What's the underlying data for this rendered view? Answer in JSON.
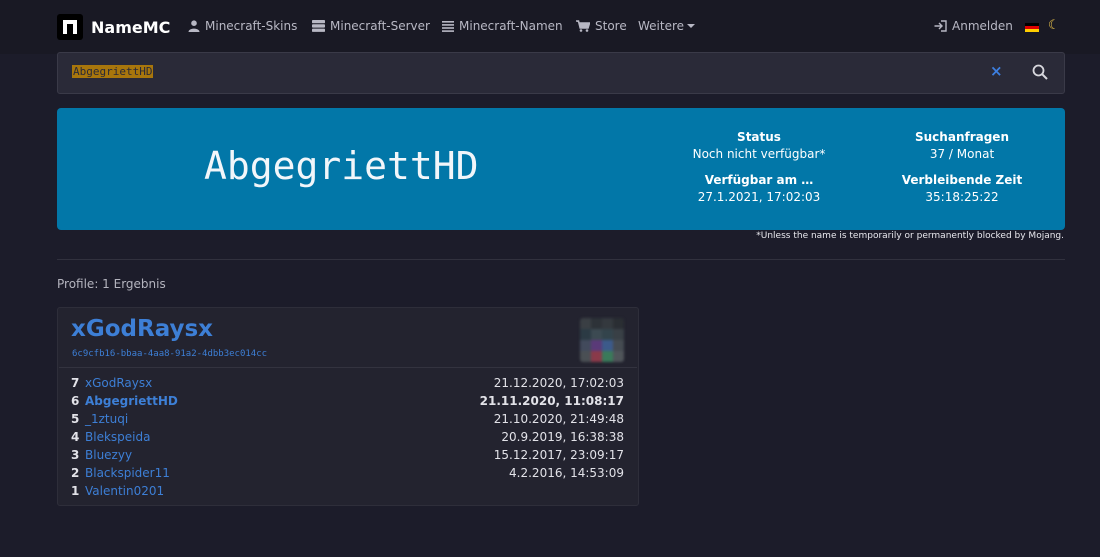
{
  "nav": {
    "brand": "NameMC",
    "items": [
      {
        "label": "Minecraft-Skins",
        "icon": "user-icon"
      },
      {
        "label": "Minecraft-Server",
        "icon": "server-icon"
      },
      {
        "label": "Minecraft-Namen",
        "icon": "list-icon"
      },
      {
        "label": "Store",
        "icon": "cart-icon"
      },
      {
        "label": "Weitere",
        "icon": "caret-down-icon"
      }
    ],
    "login": "Anmelden",
    "language_flag": "de-flag-icon",
    "theme_icon": "moon-icon"
  },
  "search": {
    "value": "AbgegriettHD"
  },
  "banner": {
    "name": "AbgegriettHD",
    "stats": [
      {
        "label": "Status",
        "value": "Noch nicht verfügbar*"
      },
      {
        "label": "Suchanfragen",
        "value": "37 / Monat"
      },
      {
        "label": "Verfügbar am …",
        "value": "27.1.2021, 17:02:03"
      },
      {
        "label": "Verbleibende Zeit",
        "value": "35:18:25:22"
      }
    ],
    "note": "*Unless the name is temporarily or permanently blocked by Mojang."
  },
  "results": {
    "label": "Profile: 1 Ergebnis"
  },
  "profile": {
    "name": "xGodRaysx",
    "uuid": "6c9cfb16-bbaa-4aa8-91a2-4dbb3ec014cc",
    "history": [
      {
        "num": "7",
        "name": "xGodRaysx",
        "date": "21.12.2020, 17:02:03"
      },
      {
        "num": "6",
        "name": "AbgegriettHD",
        "date": "21.11.2020, 11:08:17"
      },
      {
        "num": "5",
        "name": "_1ztuqi",
        "date": "21.10.2020, 21:49:48"
      },
      {
        "num": "4",
        "name": "Blekspeida",
        "date": "20.9.2019, 16:38:38"
      },
      {
        "num": "3",
        "name": "Bluezyy",
        "date": "15.12.2017, 23:09:17"
      },
      {
        "num": "2",
        "name": "Blackspider11",
        "date": "4.2.2016, 14:53:09"
      },
      {
        "num": "1",
        "name": "Valentin0201",
        "date": ""
      }
    ]
  },
  "colors": {
    "banner": "#0277a8",
    "link": "#3d7fd6",
    "background": "#1c1c2a"
  }
}
